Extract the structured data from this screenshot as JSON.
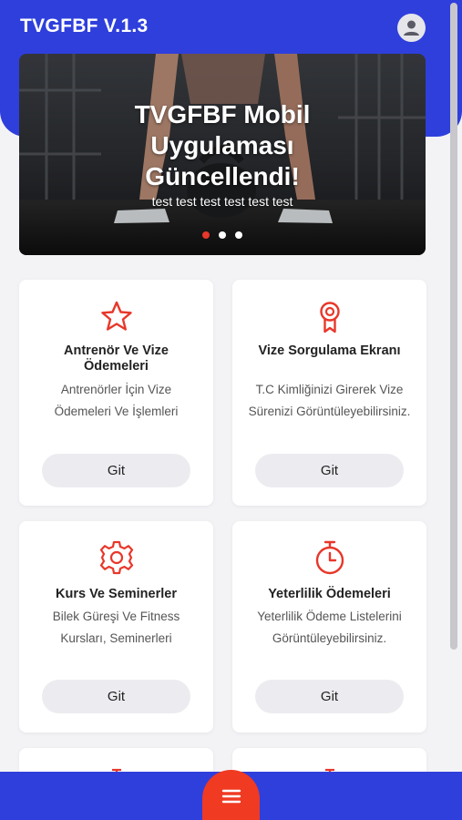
{
  "app": {
    "title": "TVGFBF V.1.3"
  },
  "slider": {
    "title": "TVGFBF Mobil Uygulaması Güncellendi!",
    "subtitle": "test test test test test test",
    "dot_count": 3,
    "active_dot": 0
  },
  "cards": [
    {
      "icon": "star-icon",
      "title": "Antrenör Ve Vize Ödemeleri",
      "description": "Antrenörler İçin Vize Ödemeleri Ve İşlemleri",
      "button": "Git"
    },
    {
      "icon": "award-ribbon-icon",
      "title": "Vize Sorgulama Ekranı",
      "description": "T.C Kimliğinizi Girerek Vize Sürenizi Görüntüleyebilirsiniz.",
      "button": "Git"
    },
    {
      "icon": "gear-icon",
      "title": "Kurs Ve Seminerler",
      "description": "Bilek Güreşi Ve Fitness Kursları, Seminerleri",
      "button": "Git"
    },
    {
      "icon": "stopwatch-icon",
      "title": "Yeterlilik Ödemeleri",
      "description": "Yeterlilik Ödeme Listelerini Görüntüleyebilirsiniz.",
      "button": "Git"
    }
  ],
  "colors": {
    "primary": "#2f3fdc",
    "accent": "#f03a22",
    "icon": "#e8372a",
    "background": "#f3f3f6"
  },
  "bottom_nav": {
    "fab_icon": "menu-icon"
  }
}
